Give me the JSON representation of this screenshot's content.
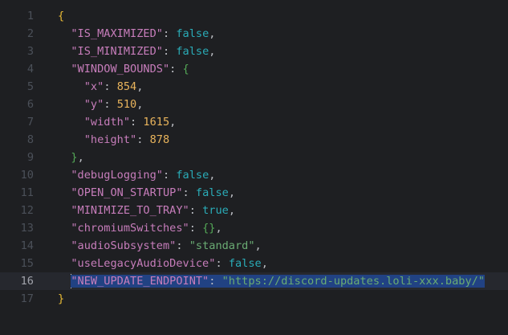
{
  "editor": {
    "current_line": 16,
    "lines": [
      {
        "no": "1",
        "indent": "",
        "tokens": [
          {
            "t": "{",
            "c": "brace"
          }
        ]
      },
      {
        "no": "2",
        "indent": "  ",
        "tokens": [
          {
            "t": "\"IS_MAXIMIZED\"",
            "c": "key"
          },
          {
            "t": ": ",
            "c": "punc"
          },
          {
            "t": "false",
            "c": "bool"
          },
          {
            "t": ",",
            "c": "punc"
          }
        ]
      },
      {
        "no": "3",
        "indent": "  ",
        "tokens": [
          {
            "t": "\"IS_MINIMIZED\"",
            "c": "key"
          },
          {
            "t": ": ",
            "c": "punc"
          },
          {
            "t": "false",
            "c": "bool"
          },
          {
            "t": ",",
            "c": "punc"
          }
        ]
      },
      {
        "no": "4",
        "indent": "  ",
        "tokens": [
          {
            "t": "\"WINDOW_BOUNDS\"",
            "c": "key"
          },
          {
            "t": ": ",
            "c": "punc"
          },
          {
            "t": "{",
            "c": "brace2"
          }
        ]
      },
      {
        "no": "5",
        "indent": "    ",
        "tokens": [
          {
            "t": "\"x\"",
            "c": "key"
          },
          {
            "t": ": ",
            "c": "punc"
          },
          {
            "t": "854",
            "c": "num"
          },
          {
            "t": ",",
            "c": "punc"
          }
        ]
      },
      {
        "no": "6",
        "indent": "    ",
        "tokens": [
          {
            "t": "\"y\"",
            "c": "key"
          },
          {
            "t": ": ",
            "c": "punc"
          },
          {
            "t": "510",
            "c": "num"
          },
          {
            "t": ",",
            "c": "punc"
          }
        ]
      },
      {
        "no": "7",
        "indent": "    ",
        "tokens": [
          {
            "t": "\"width\"",
            "c": "key"
          },
          {
            "t": ": ",
            "c": "punc"
          },
          {
            "t": "1615",
            "c": "num"
          },
          {
            "t": ",",
            "c": "punc"
          }
        ]
      },
      {
        "no": "8",
        "indent": "    ",
        "tokens": [
          {
            "t": "\"height\"",
            "c": "key"
          },
          {
            "t": ": ",
            "c": "punc"
          },
          {
            "t": "878",
            "c": "num"
          }
        ]
      },
      {
        "no": "9",
        "indent": "  ",
        "tokens": [
          {
            "t": "}",
            "c": "brace2"
          },
          {
            "t": ",",
            "c": "punc"
          }
        ]
      },
      {
        "no": "10",
        "indent": "  ",
        "tokens": [
          {
            "t": "\"debugLogging\"",
            "c": "key"
          },
          {
            "t": ": ",
            "c": "punc"
          },
          {
            "t": "false",
            "c": "bool"
          },
          {
            "t": ",",
            "c": "punc"
          }
        ]
      },
      {
        "no": "11",
        "indent": "  ",
        "tokens": [
          {
            "t": "\"OPEN_ON_STARTUP\"",
            "c": "key"
          },
          {
            "t": ": ",
            "c": "punc"
          },
          {
            "t": "false",
            "c": "bool"
          },
          {
            "t": ",",
            "c": "punc"
          }
        ]
      },
      {
        "no": "12",
        "indent": "  ",
        "tokens": [
          {
            "t": "\"MINIMIZE_TO_TRAY\"",
            "c": "key"
          },
          {
            "t": ": ",
            "c": "punc"
          },
          {
            "t": "true",
            "c": "bool"
          },
          {
            "t": ",",
            "c": "punc"
          }
        ]
      },
      {
        "no": "13",
        "indent": "  ",
        "tokens": [
          {
            "t": "\"chromiumSwitches\"",
            "c": "key"
          },
          {
            "t": ": ",
            "c": "punc"
          },
          {
            "t": "{}",
            "c": "brace2"
          },
          {
            "t": ",",
            "c": "punc"
          }
        ]
      },
      {
        "no": "14",
        "indent": "  ",
        "tokens": [
          {
            "t": "\"audioSubsystem\"",
            "c": "key"
          },
          {
            "t": ": ",
            "c": "punc"
          },
          {
            "t": "\"standard\"",
            "c": "str"
          },
          {
            "t": ",",
            "c": "punc"
          }
        ]
      },
      {
        "no": "15",
        "indent": "  ",
        "tokens": [
          {
            "t": "\"useLegacyAudioDevice\"",
            "c": "key"
          },
          {
            "t": ": ",
            "c": "punc"
          },
          {
            "t": "false",
            "c": "bool"
          },
          {
            "t": ",",
            "c": "punc"
          }
        ]
      },
      {
        "no": "16",
        "indent": "  ",
        "selected": true,
        "tokens": [
          {
            "t": "\"NEW_UPDATE_ENDPOINT\"",
            "c": "key"
          },
          {
            "t": ": ",
            "c": "punc"
          },
          {
            "t": "\"https://discord-updates.loli-xxx.baby/\"",
            "c": "str"
          }
        ]
      },
      {
        "no": "17",
        "indent": "",
        "tokens": [
          {
            "t": "}",
            "c": "brace"
          }
        ]
      }
    ]
  }
}
